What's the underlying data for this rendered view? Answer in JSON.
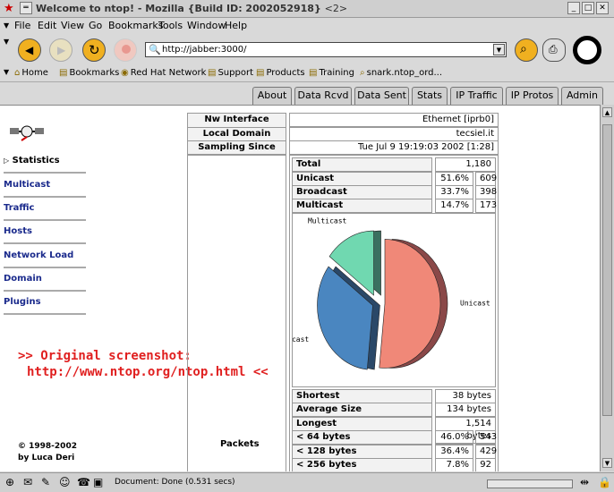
{
  "window": {
    "title": "Welcome to ntop! - Mozilla {Build ID: 2002052918}",
    "title_suffix": "<2>"
  },
  "menu": [
    "File",
    "Edit",
    "View",
    "Go",
    "Bookmarks",
    "Tools",
    "Window",
    "Help"
  ],
  "url": "http://jabber:3000/",
  "bookmarks": [
    "Home",
    "Bookmarks",
    "Red Hat Network",
    "Support",
    "Products",
    "Training",
    "snark.ntop_ord..."
  ],
  "tabs": [
    "About",
    "Data Rcvd",
    "Data Sent",
    "Stats",
    "IP Traffic",
    "IP Protos",
    "Admin"
  ],
  "sidebar": {
    "statistics": "Statistics",
    "items": [
      "Multicast",
      "Traffic",
      "Hosts",
      "Network Load",
      "Domain",
      "Plugins"
    ]
  },
  "promo": [
    ">> Original screenshot:",
    "http://www.ntop.org/ntop.html <<"
  ],
  "copyright": [
    "© 1998-2002",
    "by Luca Deri"
  ],
  "info": [
    {
      "label": "Nw Interface Type",
      "value": "Ethernet [iprb0]"
    },
    {
      "label": "Local Domain Name",
      "value": "tecsiel.it"
    },
    {
      "label": "Sampling Since",
      "value": "Tue Jul  9 19:19:03 2002 [1:28]"
    }
  ],
  "packets_label": "Packets",
  "traffic": [
    {
      "label": "Total",
      "pct": "",
      "value": "1,180"
    },
    {
      "label": "Unicast",
      "pct": "51.6%",
      "value": "609"
    },
    {
      "label": "Broadcast",
      "pct": "33.7%",
      "value": "398"
    },
    {
      "label": "Multicast",
      "pct": "14.7%",
      "value": "173"
    }
  ],
  "sizes": [
    {
      "label": "Shortest",
      "value": "38 bytes"
    },
    {
      "label": "Average Size",
      "value": "134 bytes"
    },
    {
      "label": "Longest",
      "value": "1,514 bytes"
    },
    {
      "label": "< 64 bytes",
      "pct": "46.0%",
      "value": "543"
    },
    {
      "label": "< 128 bytes",
      "pct": "36.4%",
      "value": "429"
    },
    {
      "label": "< 256 bytes",
      "pct": "7.8%",
      "value": "92"
    }
  ],
  "status": "Document: Done (0.531 secs)",
  "chart_data": {
    "type": "pie",
    "categories": [
      "Unicast",
      "Broadcast",
      "Multicast"
    ],
    "values": [
      51.6,
      33.7,
      14.7
    ],
    "colors": [
      "#f08878",
      "#4a86c0",
      "#70d8b0"
    ]
  }
}
